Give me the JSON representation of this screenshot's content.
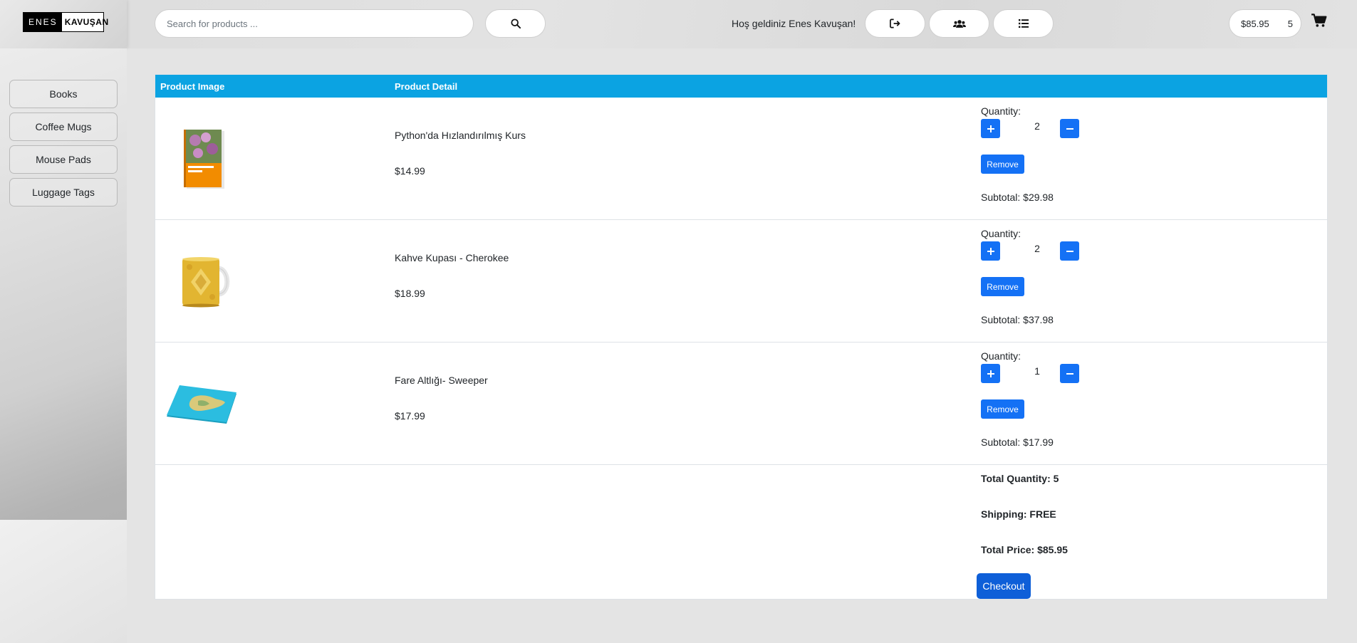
{
  "brand": {
    "part1": "ENES",
    "part2": "KAVUŞAN"
  },
  "search": {
    "placeholder": "Search for products ..."
  },
  "header": {
    "welcome": "Hoş geldiniz Enes Kavuşan!",
    "cart_total": "$85.95",
    "cart_count": "5"
  },
  "icons": {
    "search": "search-icon",
    "logout": "sign-out-icon",
    "users": "users-icon",
    "orders": "list-icon",
    "cart": "shopping-cart-icon"
  },
  "sidebar": {
    "items": [
      {
        "label": "Books"
      },
      {
        "label": "Coffee Mugs"
      },
      {
        "label": "Mouse Pads"
      },
      {
        "label": "Luggage Tags"
      }
    ]
  },
  "table": {
    "headers": [
      "Product Image",
      "Product Detail"
    ],
    "rows": [
      {
        "name": "Python'da Hızlandırılmış Kurs",
        "price": "$14.99",
        "qty_label": "Quantity:",
        "qty": "2",
        "remove": "Remove",
        "subtotal": "Subtotal: $29.98",
        "image": "book"
      },
      {
        "name": "Kahve Kupası - Cherokee",
        "price": "$18.99",
        "qty_label": "Quantity:",
        "qty": "2",
        "remove": "Remove",
        "subtotal": "Subtotal: $37.98",
        "image": "mug"
      },
      {
        "name": "Fare Altlığı- Sweeper",
        "price": "$17.99",
        "qty_label": "Quantity:",
        "qty": "1",
        "remove": "Remove",
        "subtotal": "Subtotal: $17.99",
        "image": "mousepad"
      }
    ]
  },
  "summary": {
    "total_quantity": "Total Quantity: 5",
    "shipping": "Shipping: FREE",
    "total_price": "Total Price: $85.95",
    "checkout": "Checkout"
  },
  "colors": {
    "table_header": "#0ba3e2",
    "button_blue": "#1471f5",
    "checkout_blue": "#0e5fd8"
  }
}
